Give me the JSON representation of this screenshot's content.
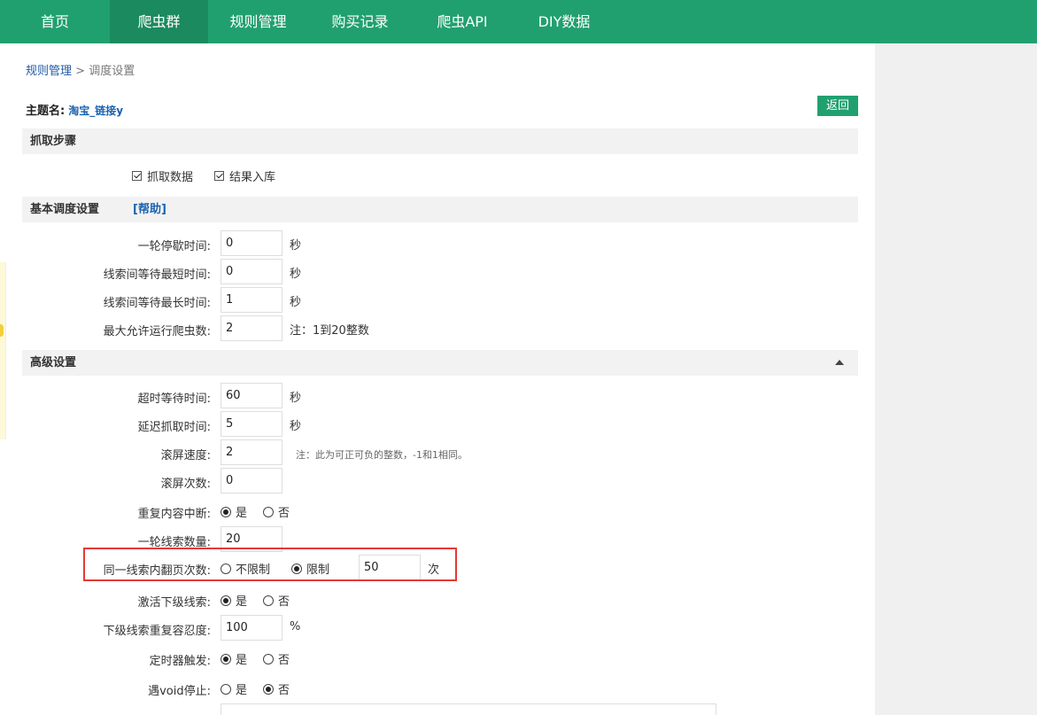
{
  "nav": {
    "items": [
      {
        "label": "首页",
        "active": false
      },
      {
        "label": "爬虫群",
        "active": true
      },
      {
        "label": "规则管理",
        "active": false
      },
      {
        "label": "购买记录",
        "active": false
      },
      {
        "label": "爬虫API",
        "active": false
      },
      {
        "label": "DIY数据",
        "active": false
      }
    ]
  },
  "breadcrumb": {
    "parent": "规则管理",
    "separator": ">",
    "current": "调度设置"
  },
  "theme": {
    "label": "主题名:",
    "value": "淘宝_链接y"
  },
  "back_label": "返回",
  "sections": {
    "steps": {
      "title": "抓取步骤",
      "items": [
        "抓取数据",
        "结果入库"
      ]
    },
    "basic": {
      "title": "基本调度设置",
      "help": "[帮助]"
    },
    "advanced": {
      "title": "高级设置"
    }
  },
  "basic_fields": [
    {
      "label": "一轮停歇时间:",
      "value": "0",
      "unit": "秒"
    },
    {
      "label": "线索间等待最短时间:",
      "value": "0",
      "unit": "秒"
    },
    {
      "label": "线索间等待最长时间:",
      "value": "1",
      "unit": "秒"
    },
    {
      "label": "最大允许运行爬虫数:",
      "value": "2",
      "unit": "注：1到20整数"
    }
  ],
  "advanced_fields": {
    "timeout": {
      "label": "超时等待时间:",
      "value": "60",
      "unit": "秒"
    },
    "delay": {
      "label": "延迟抓取时间:",
      "value": "5",
      "unit": "秒"
    },
    "scroll_speed": {
      "label": "滚屏速度:",
      "value": "2",
      "note": "注：此为可正可负的整数，-1和1相同。"
    },
    "scroll_count": {
      "label": "滚屏次数:",
      "value": "0"
    },
    "repeat_break": {
      "label": "重复内容中断:",
      "yes": "是",
      "no": "否"
    },
    "clues_per_round": {
      "label": "一轮线索数量:",
      "value": "20"
    },
    "page_turns": {
      "label": "同一线索内翻页次数:",
      "unlimited": "不限制",
      "limited": "限制",
      "value": "50",
      "unit": "次"
    },
    "activate_sub": {
      "label": "激活下级线索:",
      "yes": "是",
      "no": "否"
    },
    "sub_tolerance": {
      "label": "下级线索重复容忍度:",
      "value": "100",
      "unit": "%"
    },
    "timer_trigger": {
      "label": "定时器触发:",
      "yes": "是",
      "no": "否"
    },
    "void_stop": {
      "label": "遇void停止:",
      "yes": "是",
      "no": "否"
    }
  },
  "colors": {
    "accent": "#21a06f",
    "nav_active": "#1b8a5e",
    "highlight": "#e53935",
    "link": "#1a63b0"
  }
}
